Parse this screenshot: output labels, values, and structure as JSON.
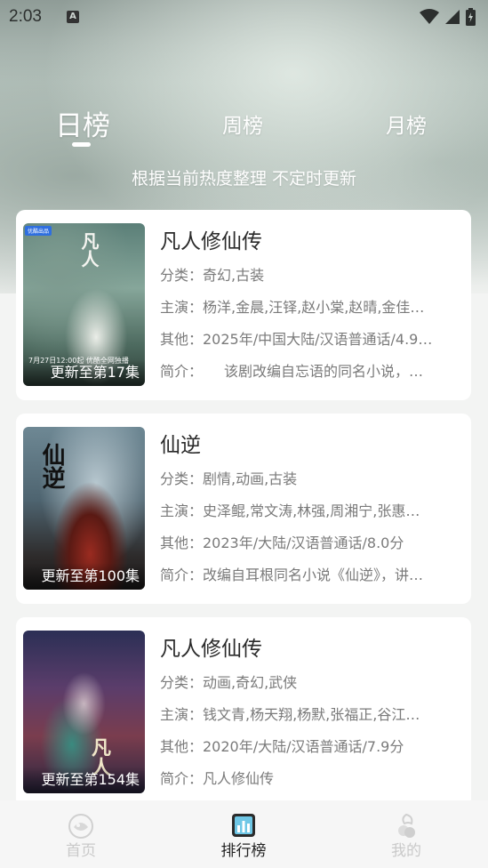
{
  "status_bar": {
    "time": "2:03",
    "notif_letter": "A"
  },
  "tabs": {
    "day": "日榜",
    "week": "周榜",
    "month": "月榜",
    "selected": "日榜"
  },
  "subtitle": "根据当前热度整理 不定时更新",
  "cards": [
    {
      "title": "凡人修仙传",
      "category": "分类：奇幻,古装",
      "cast": "主演：杨洋,金晨,汪铎,赵小棠,赵晴,金佳…",
      "other": "其他：2025年/中国大陆/汉语普通话/4.9…",
      "intro": "简介：　　该剧改编自忘语的同名小说，…",
      "episode": "更新至第17集",
      "poster_badge": "优酷出品",
      "poster_date": "7月27日12:00起 优酷全网独播",
      "poster_vtitle": "凡人"
    },
    {
      "title": "仙逆",
      "category": "分类：剧情,动画,古装",
      "cast": "主演：史泽鲲,常文涛,林强,周湘宁,张惠…",
      "other": "其他：2023年/大陆/汉语普通话/8.0分",
      "intro": "简介：改编自耳根同名小说《仙逆》，讲…",
      "episode": "更新至第100集",
      "poster_vtitle": "仙逆"
    },
    {
      "title": "凡人修仙传",
      "category": "分类：动画,奇幻,武侠",
      "cast": "主演：钱文青,杨天翔,杨默,张福正,谷江…",
      "other": "其他：2020年/大陆/汉语普通话/7.9分",
      "intro": "简介：凡人修仙传",
      "episode": "更新至第154集",
      "poster_vtitle": "凡人"
    }
  ],
  "bottom_nav": {
    "items": [
      {
        "label": "首页",
        "icon": "home-icon"
      },
      {
        "label": "排行榜",
        "icon": "ranking-icon"
      },
      {
        "label": "我的",
        "icon": "profile-icon"
      }
    ],
    "active": "排行榜"
  },
  "colors": {
    "text_primary": "#2a2a2a",
    "text_secondary": "#7a7a7a",
    "nav_inactive": "#c9c9c9",
    "nav_active": "#222222",
    "card_bg": "#ffffff"
  }
}
